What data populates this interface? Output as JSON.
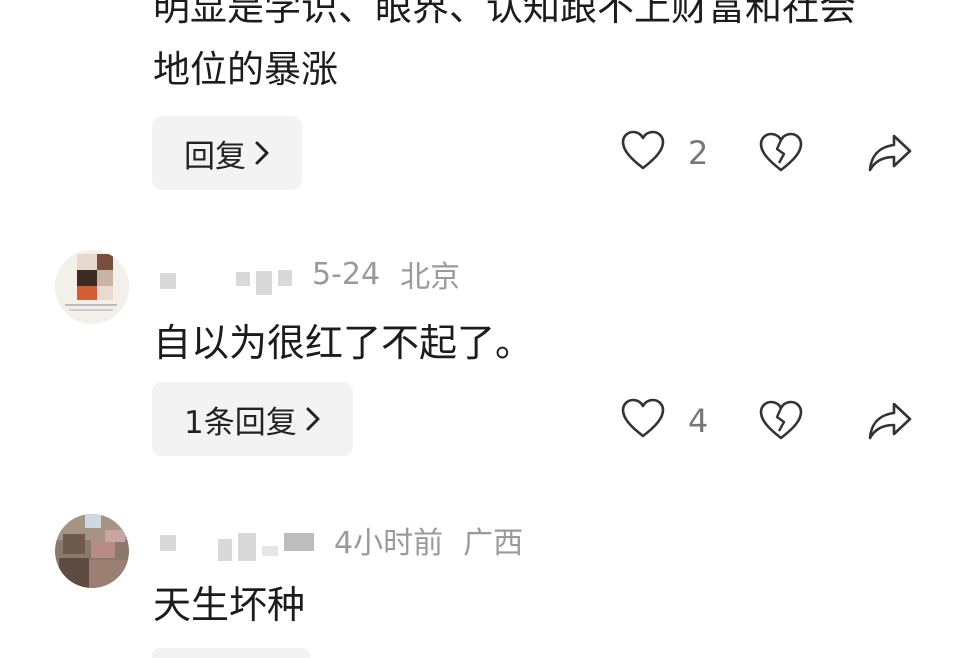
{
  "comment0": {
    "text_lines": [
      "明显是学识、眼界、认知跟不上财富和社会",
      "地位的暴涨"
    ],
    "reply_label": "回复",
    "like_count": "2"
  },
  "comment1": {
    "date": "5-24",
    "location": "北京",
    "text": "自以为很红了不起了。",
    "reply_label": "1条回复",
    "like_count": "4"
  },
  "comment2": {
    "time": "4小时前",
    "location": "广西",
    "text": "天生坏种"
  },
  "icons": [
    "heart-icon",
    "broken-heart-icon",
    "share-icon",
    "chevron-right-icon"
  ]
}
